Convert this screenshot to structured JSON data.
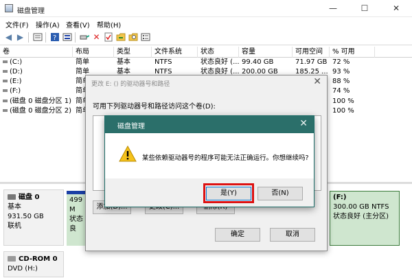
{
  "window": {
    "title": "磁盘管理",
    "min": "—",
    "max": "☐",
    "close": "✕"
  },
  "menu": [
    "文件(F)",
    "操作(A)",
    "查看(V)",
    "帮助(H)"
  ],
  "toolbar_icons": [
    "back-arrow",
    "forward-arrow",
    "properties",
    "help",
    "disk-list",
    "delete",
    "check",
    "folder-open",
    "folder-search",
    "list-view"
  ],
  "columns": [
    "卷",
    "布局",
    "类型",
    "文件系统",
    "状态",
    "容量",
    "可用空间",
    "% 可用"
  ],
  "volumes": [
    {
      "name": "(C:)",
      "layout": "简单",
      "type": "基本",
      "fs": "NTFS",
      "status": "状态良好 (...",
      "capacity": "99.40 GB",
      "free": "71.97 GB",
      "pct": "72 %"
    },
    {
      "name": "(D:)",
      "layout": "简单",
      "type": "基本",
      "fs": "NTFS",
      "status": "状态良好 (...",
      "capacity": "200.00 GB",
      "free": "185.25 ...",
      "pct": "93 %"
    },
    {
      "name": "(E:)",
      "layout": "简单",
      "type": "",
      "fs": "",
      "status": "",
      "capacity": "",
      "free": "",
      "pct": "88 %"
    },
    {
      "name": "(F:)",
      "layout": "简单",
      "type": "",
      "fs": "",
      "status": "",
      "capacity": "",
      "free": "",
      "pct": "74 %"
    },
    {
      "name": "(磁盘 0 磁盘分区 1)",
      "layout": "简单",
      "type": "",
      "fs": "",
      "status": "",
      "capacity": "",
      "free": "",
      "pct": "100 %"
    },
    {
      "name": "(磁盘 0 磁盘分区 2)",
      "layout": "简单",
      "type": "",
      "fs": "",
      "status": "",
      "capacity": "",
      "free": "",
      "pct": "100 %"
    }
  ],
  "disks": [
    {
      "name": "磁盘 0",
      "type": "基本",
      "size": "931.50 GB",
      "state": "联机"
    },
    {
      "name": "CD-ROM 0",
      "type": "DVD (H:)"
    }
  ],
  "partitions": {
    "left": {
      "size": "499 M",
      "status": "状态良"
    },
    "right": {
      "name": "(F:)",
      "info": "300.00 GB NTFS",
      "status": "状态良好 (主分区)"
    }
  },
  "change_dialog": {
    "title": "更改 E: () 的驱动器号和路径",
    "close": "✕",
    "prompt": "可用下列驱动器号和路径访问这个卷(D):",
    "add": "添加(D)...",
    "change": "更改(C)...",
    "remove": "删除(R)",
    "ok": "确定",
    "cancel": "取消"
  },
  "confirm_dialog": {
    "title": "磁盘管理",
    "close": "✕",
    "message": "某些依赖驱动器号的程序可能无法正确运行。你想继续吗?",
    "yes": "是(Y)",
    "no": "否(N)"
  },
  "colors": {
    "accent": "#2b6f6a",
    "highlight": "#dd1111",
    "partition": "#cfe6cf",
    "partition_bar": "#1b3fa5"
  }
}
